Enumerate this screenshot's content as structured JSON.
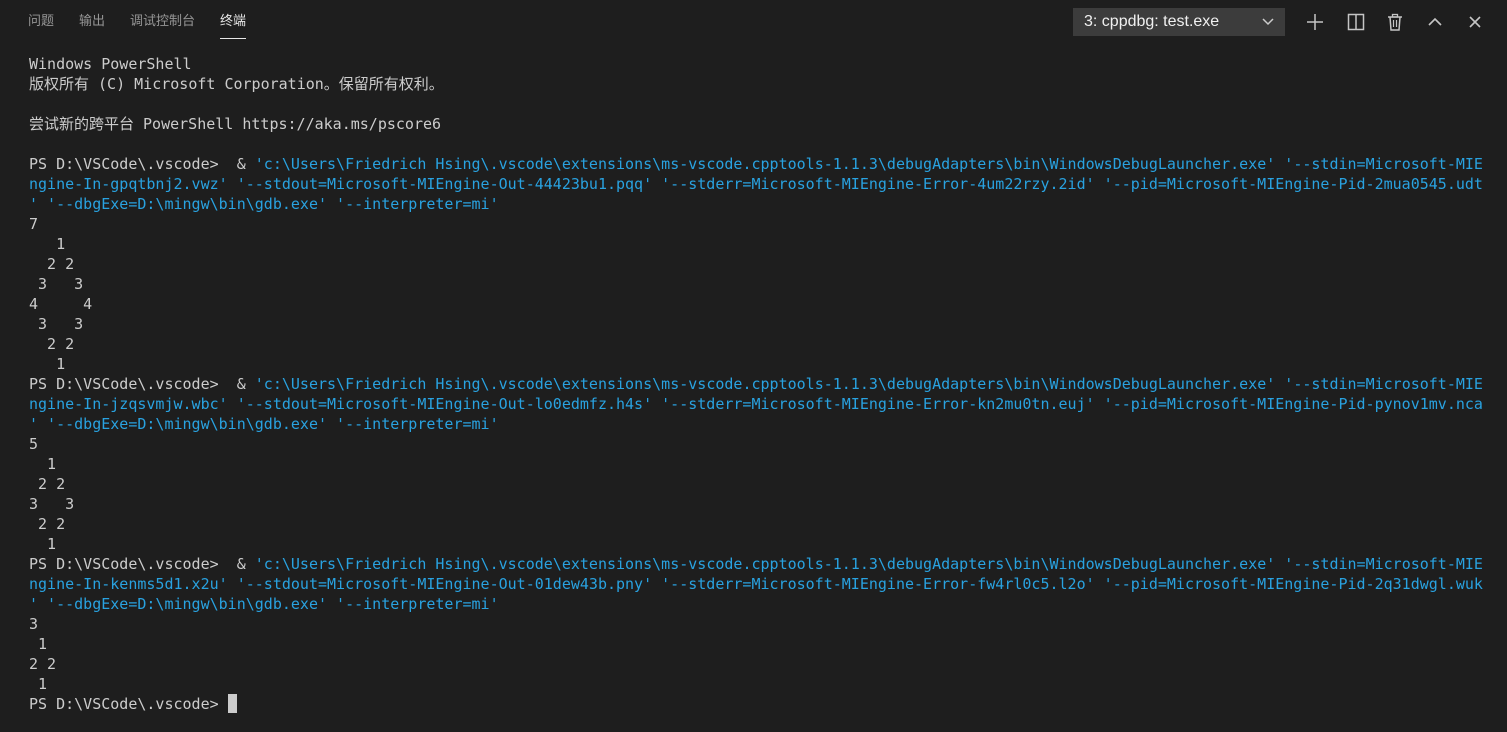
{
  "tabs": [
    {
      "label": "问题",
      "active": false
    },
    {
      "label": "输出",
      "active": false
    },
    {
      "label": "调试控制台",
      "active": false
    },
    {
      "label": "终端",
      "active": true
    }
  ],
  "terminal_select": {
    "value": "3: cppdbg: test.exe"
  },
  "actions": [
    {
      "icon": "plus-icon",
      "name": "new-terminal-button"
    },
    {
      "icon": "split-icon",
      "name": "split-terminal-button"
    },
    {
      "icon": "trash-icon",
      "name": "kill-terminal-button"
    },
    {
      "icon": "chevron-up-icon",
      "name": "maximize-panel-button"
    },
    {
      "icon": "close-icon",
      "name": "close-panel-button"
    }
  ],
  "colors": {
    "background": "#1e1e1e",
    "text": "#cccccc",
    "string": "#29a2e0",
    "tab_active": "#e7e7e7",
    "tab_inactive": "#969696"
  },
  "terminal": {
    "lines": [
      {
        "text": "Windows PowerShell"
      },
      {
        "text": "版权所有 (C) Microsoft Corporation。保留所有权利。"
      },
      {
        "text": ""
      },
      {
        "text": "尝试新的跨平台 PowerShell https://aka.ms/pscore6"
      },
      {
        "text": ""
      },
      {
        "prompt": "PS D:\\VSCode\\.vscode>  & ",
        "str": "'c:\\Users\\Friedrich Hsing\\.vscode\\extensions\\ms-vscode.cpptools-1.1.3\\debugAdapters\\bin\\WindowsDebugLauncher.exe' '--stdin=Microsoft-MIE"
      },
      {
        "str": "ngine-In-gpqtbnj2.vwz' '--stdout=Microsoft-MIEngine-Out-44423bu1.pqq' '--stderr=Microsoft-MIEngine-Error-4um22rzy.2id' '--pid=Microsoft-MIEngine-Pid-2mua0545.udt"
      },
      {
        "str": "' '--dbgExe=D:\\mingw\\bin\\gdb.exe' '--interpreter=mi'"
      },
      {
        "text": "7"
      },
      {
        "text": "   1"
      },
      {
        "text": "  2 2"
      },
      {
        "text": " 3   3"
      },
      {
        "text": "4     4"
      },
      {
        "text": " 3   3"
      },
      {
        "text": "  2 2"
      },
      {
        "text": "   1"
      },
      {
        "prompt": "PS D:\\VSCode\\.vscode>  & ",
        "str": "'c:\\Users\\Friedrich Hsing\\.vscode\\extensions\\ms-vscode.cpptools-1.1.3\\debugAdapters\\bin\\WindowsDebugLauncher.exe' '--stdin=Microsoft-MIE"
      },
      {
        "str": "ngine-In-jzqsvmjw.wbc' '--stdout=Microsoft-MIEngine-Out-lo0edmfz.h4s' '--stderr=Microsoft-MIEngine-Error-kn2mu0tn.euj' '--pid=Microsoft-MIEngine-Pid-pynov1mv.nca"
      },
      {
        "str": "' '--dbgExe=D:\\mingw\\bin\\gdb.exe' '--interpreter=mi'"
      },
      {
        "text": "5"
      },
      {
        "text": "  1"
      },
      {
        "text": " 2 2"
      },
      {
        "text": "3   3"
      },
      {
        "text": " 2 2"
      },
      {
        "text": "  1"
      },
      {
        "prompt": "PS D:\\VSCode\\.vscode>  & ",
        "str": "'c:\\Users\\Friedrich Hsing\\.vscode\\extensions\\ms-vscode.cpptools-1.1.3\\debugAdapters\\bin\\WindowsDebugLauncher.exe' '--stdin=Microsoft-MIE"
      },
      {
        "str": "ngine-In-kenms5d1.x2u' '--stdout=Microsoft-MIEngine-Out-01dew43b.pny' '--stderr=Microsoft-MIEngine-Error-fw4rl0c5.l2o' '--pid=Microsoft-MIEngine-Pid-2q31dwgl.wuk"
      },
      {
        "str": "' '--dbgExe=D:\\mingw\\bin\\gdb.exe' '--interpreter=mi'"
      },
      {
        "text": "3"
      },
      {
        "text": " 1"
      },
      {
        "text": "2 2"
      },
      {
        "text": " 1"
      },
      {
        "prompt": "PS D:\\VSCode\\.vscode> ",
        "cursor": true
      }
    ]
  }
}
